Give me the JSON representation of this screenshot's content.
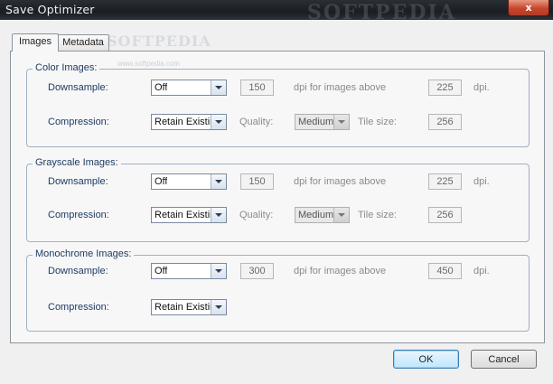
{
  "window": {
    "title": "Save Optimizer",
    "close_glyph": "x",
    "watermark": "SOFTPEDIA",
    "watermark_small": "www.softpedia.com"
  },
  "tabs": [
    {
      "label": "Images",
      "active": true
    },
    {
      "label": "Metadata",
      "active": false
    }
  ],
  "groups": [
    {
      "title": "Color Images:",
      "downsample": {
        "label": "Downsample:",
        "value": "Off",
        "dpi": "150",
        "dpi_label": "dpi for images above",
        "above": "225",
        "unit": "dpi."
      },
      "compression": {
        "label": "Compression:",
        "value": "Retain Existin",
        "quality_label": "Quality:",
        "quality": "Medium",
        "tile_label": "Tile size:",
        "tile": "256"
      }
    },
    {
      "title": "Grayscale Images:",
      "downsample": {
        "label": "Downsample:",
        "value": "Off",
        "dpi": "150",
        "dpi_label": "dpi for images above",
        "above": "225",
        "unit": "dpi."
      },
      "compression": {
        "label": "Compression:",
        "value": "Retain Existin",
        "quality_label": "Quality:",
        "quality": "Medium",
        "tile_label": "Tile size:",
        "tile": "256"
      }
    },
    {
      "title": "Monochrome Images:",
      "downsample": {
        "label": "Downsample:",
        "value": "Off",
        "dpi": "300",
        "dpi_label": "dpi for images above",
        "above": "450",
        "unit": "dpi."
      },
      "compression": {
        "label": "Compression:",
        "value": "Retain Existin"
      }
    }
  ],
  "buttons": {
    "ok": "OK",
    "cancel": "Cancel"
  },
  "colors": {
    "label": "#1f3b63",
    "group_border": "#9fb0c5",
    "ok_button": "#bee6fd"
  }
}
